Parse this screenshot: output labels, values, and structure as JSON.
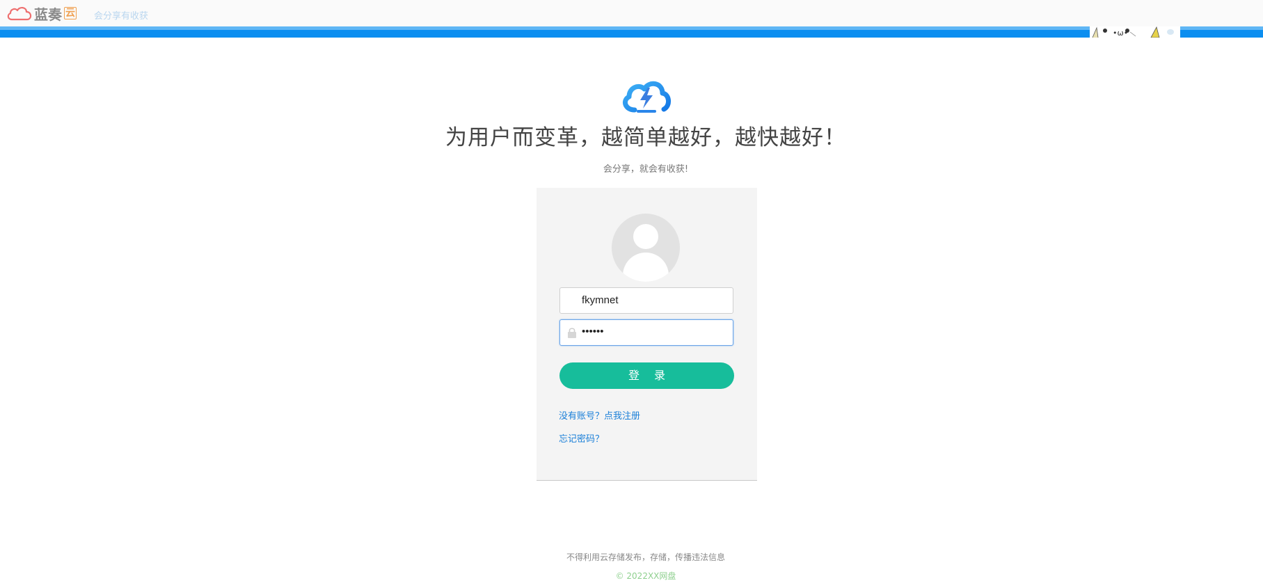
{
  "header": {
    "brand_name": "蓝奏",
    "brand_badge": "云",
    "slogan": "会分享有收获",
    "mascot_text": "•ω•"
  },
  "hero": {
    "icon": "cloud-lightning-icon",
    "headline": "为用户而变革，越简单越好，越快越好！",
    "subline": "会分享，就会有收获!"
  },
  "login_form": {
    "avatar_icon": "user-avatar-icon",
    "username_value": "fkymnet",
    "password_value": "••••••",
    "password_icon": "lock-icon",
    "login_label": "登 录",
    "register_link": "没有账号？点我注册",
    "forgot_link": "忘记密码？"
  },
  "footer": {
    "notice": "不得利用云存储发布，存储，传播违法信息",
    "copyright": "© 2022XX网盘"
  },
  "colors": {
    "brand_blue": "#0b8ef0",
    "button_green": "#17bd9b",
    "link_blue": "#1a7fd8",
    "logo_red": "#ee6f6f",
    "copyright_green": "#8fd08f"
  }
}
